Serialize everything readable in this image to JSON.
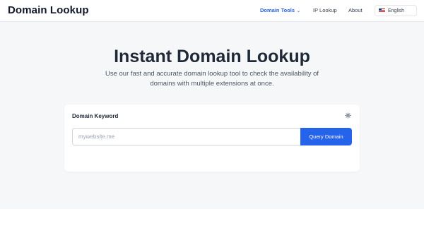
{
  "header": {
    "brand": "Domain Lookup",
    "nav": {
      "domain_tools": "Domain Tools",
      "ip_lookup": "IP Lookup",
      "about": "About"
    },
    "language": "English"
  },
  "hero": {
    "title": "Instant Domain Lookup",
    "subtitle_line1": "Use our fast and accurate domain lookup tool to check the availability of",
    "subtitle_line2": "domains with multiple extensions at once."
  },
  "search": {
    "label": "Domain Keyword",
    "value": "",
    "placeholder": "mywebsite.me",
    "button_label": "Query Domain"
  },
  "colors": {
    "accent": "#2563eb",
    "background": "#f6f7f9"
  },
  "icons": {
    "dropdown": "chevron-down-icon",
    "language_flag": "us-flag-icon",
    "settings": "gear-icon"
  }
}
